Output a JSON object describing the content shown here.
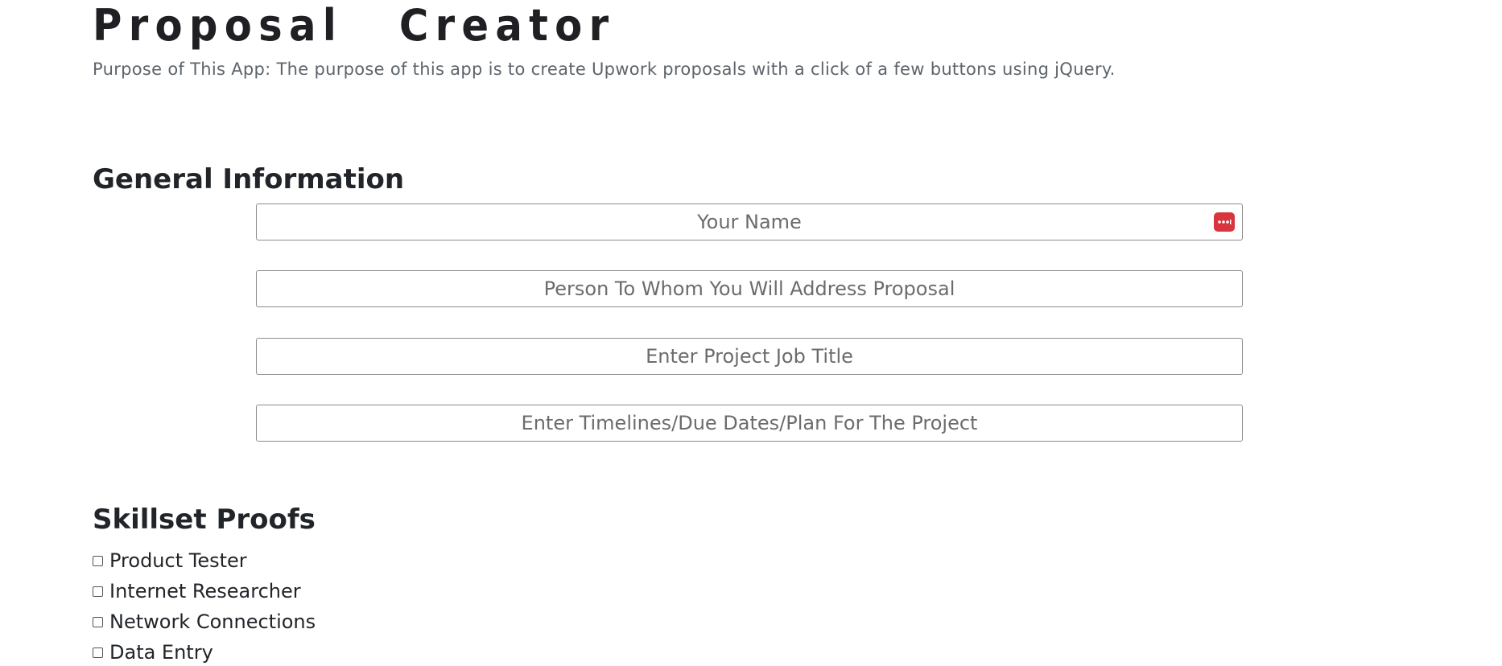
{
  "header": {
    "title": "Proposal Creator",
    "purpose": "Purpose of This App: The purpose of this app is to create Upwork proposals with a click of a few buttons using jQuery."
  },
  "general": {
    "heading": "General Information",
    "fields": {
      "name": {
        "value": "",
        "placeholder": "Your Name"
      },
      "client": {
        "value": "",
        "placeholder": "Person To Whom You Will Address Proposal"
      },
      "job_title": {
        "value": "",
        "placeholder": "Enter Project Job Title"
      },
      "timeline": {
        "value": "",
        "placeholder": "Enter Timelines/Due Dates/Plan For The Project"
      }
    },
    "password_manager_icon": "password-manager-icon",
    "accent_color": "#d9353e"
  },
  "skills": {
    "heading": "Skillset Proofs",
    "items": [
      {
        "label": "Product Tester",
        "checked": false
      },
      {
        "label": "Internet Researcher",
        "checked": false
      },
      {
        "label": "Network Connections",
        "checked": false
      },
      {
        "label": "Data Entry",
        "checked": false
      }
    ]
  }
}
